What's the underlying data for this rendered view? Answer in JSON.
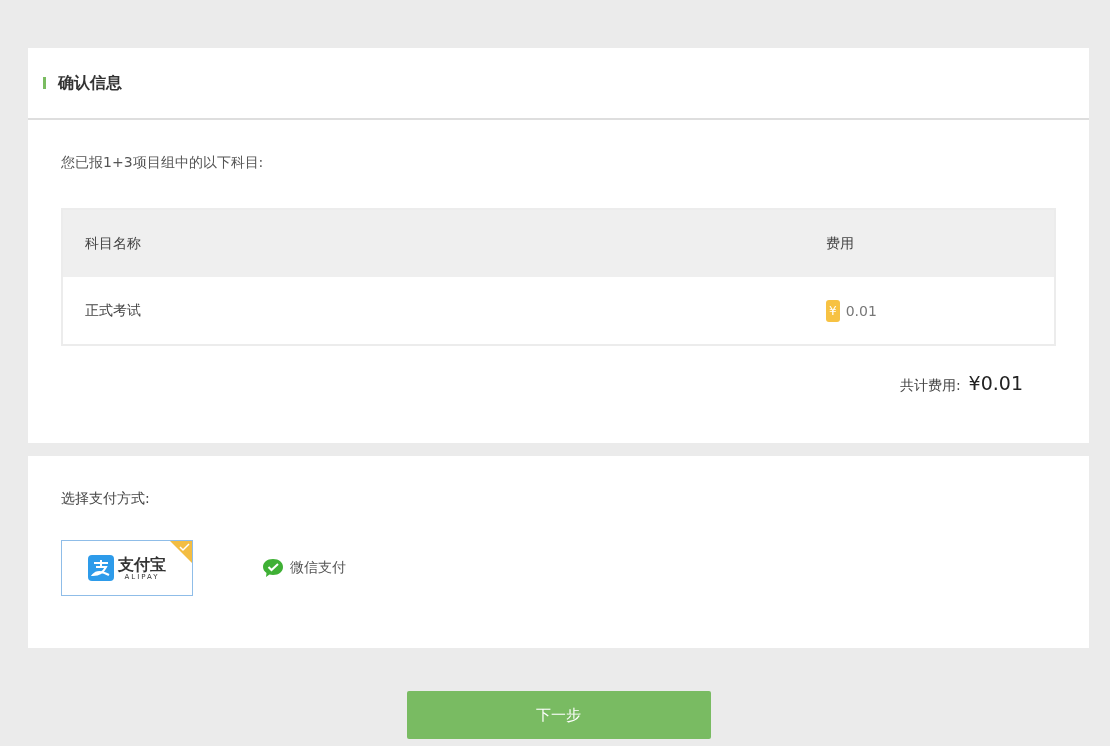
{
  "header": {
    "title": "确认信息"
  },
  "summary": {
    "intro": "您已报1+3项目组中的以下科目:",
    "table": {
      "columns": [
        "科目名称",
        "费用"
      ],
      "rows": [
        {
          "name": "正式考试",
          "currency": "¥",
          "fee": "0.01"
        }
      ]
    },
    "total_label": "共计费用:",
    "total": "¥0.01"
  },
  "payment": {
    "label": "选择支付方式:",
    "methods": [
      {
        "kind": "alipay",
        "name": "支付宝",
        "subname": "ALIPAY",
        "selected": true
      },
      {
        "kind": "wechat",
        "name": "微信支付",
        "selected": false
      }
    ]
  },
  "next_button": "下一步"
}
